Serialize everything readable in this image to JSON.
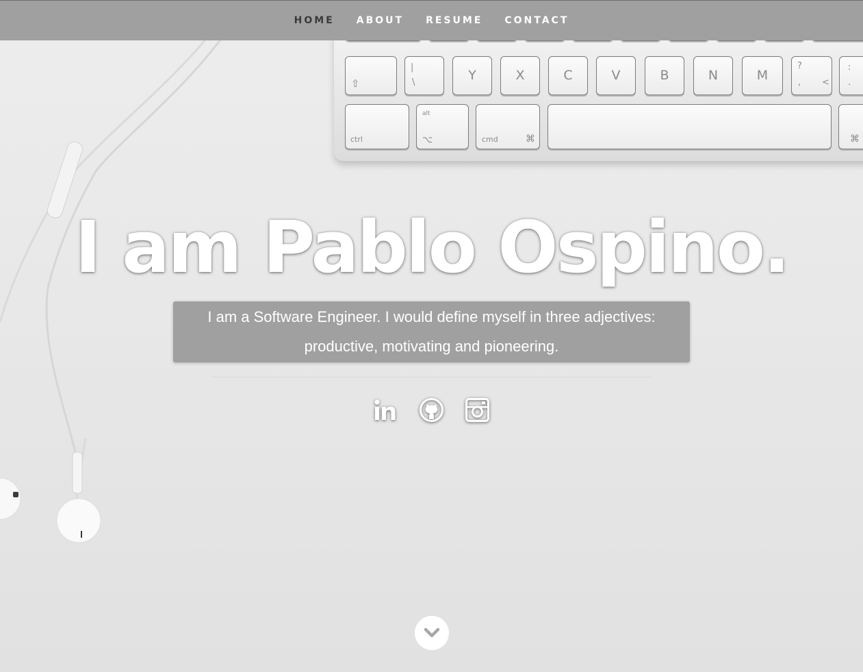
{
  "nav": {
    "items": [
      {
        "label": "HOME",
        "active": true
      },
      {
        "label": "ABOUT",
        "active": false
      },
      {
        "label": "RESUME",
        "active": false
      },
      {
        "label": "CONTACT",
        "active": false
      }
    ]
  },
  "hero": {
    "headline": "I am Pablo Ospino.",
    "intro_line1": "I am a Software Engineer. I would define myself in three adjectives:",
    "intro_line2": "productive, motivating and pioneering."
  },
  "socials": [
    {
      "icon": "linkedin-icon"
    },
    {
      "icon": "github-icon"
    },
    {
      "icon": "instagram-icon"
    }
  ],
  "scroll_icon": "chevron-down-icon",
  "keyboard_keys": {
    "row1": [
      "Y",
      "X",
      "C",
      "V",
      "B",
      "N",
      "M"
    ],
    "shift_symbol": "⇧",
    "pipe_top": "|",
    "pipe_bottom": "\\",
    "question_top": "?",
    "comma": ",",
    "lt": "<",
    "colon_top": ":",
    "period": ".",
    "ctrl": "ctrl",
    "alt": "alt",
    "option_symbol": "⌥",
    "cmd": "cmd",
    "cmd_symbol": "⌘"
  },
  "colors": {
    "nav_bg": "#a0a0a0",
    "nav_active": "#3a3a3a",
    "nav_link": "#ffffff",
    "intro_bg": "#a0a0a0"
  }
}
